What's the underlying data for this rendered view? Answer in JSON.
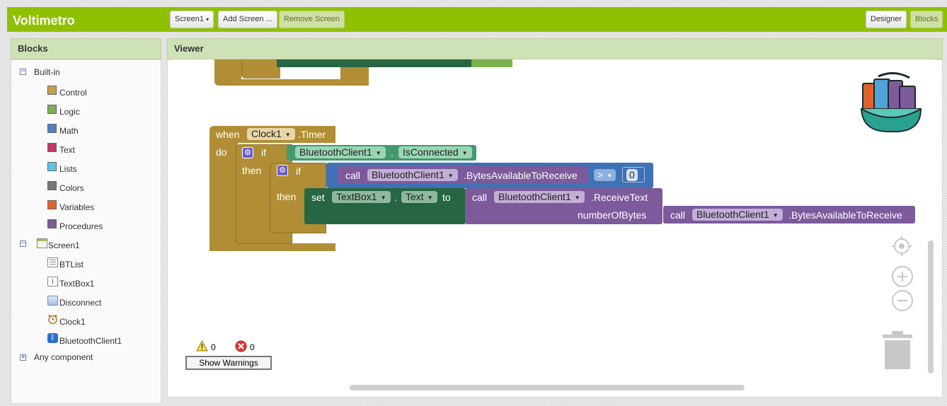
{
  "app": {
    "title": "Voltimetro"
  },
  "toolbar": {
    "screen_select": "Screen1",
    "add_screen": "Add Screen ...",
    "remove_screen": "Remove Screen",
    "designer": "Designer",
    "blocks": "Blocks"
  },
  "blocks_panel": {
    "title": "Blocks",
    "builtin": {
      "label": "Built-in",
      "items": [
        {
          "label": "Control",
          "color": "#c9a04a"
        },
        {
          "label": "Logic",
          "color": "#7db14f"
        },
        {
          "label": "Math",
          "color": "#4f7fc7"
        },
        {
          "label": "Text",
          "color": "#c4386b"
        },
        {
          "label": "Lists",
          "color": "#5fc3e5"
        },
        {
          "label": "Colors",
          "color": "#777777"
        },
        {
          "label": "Variables",
          "color": "#e0632c"
        },
        {
          "label": "Procedures",
          "color": "#7c5a9b"
        }
      ]
    },
    "screen": {
      "label": "Screen1",
      "components": [
        {
          "label": "BTList",
          "icon": "listpicker-icon"
        },
        {
          "label": "TextBox1",
          "icon": "textbox-icon"
        },
        {
          "label": "Disconnect",
          "icon": "button-icon"
        },
        {
          "label": "Clock1",
          "icon": "clock-icon"
        },
        {
          "label": "BluetoothClient1",
          "icon": "bluetooth-icon"
        }
      ]
    },
    "any_component": "Any component"
  },
  "viewer": {
    "title": "Viewer",
    "event_block": {
      "when": "when",
      "component": "Clock1",
      "event": ".Timer",
      "do": "do"
    },
    "if_outer": {
      "if": "if",
      "then": "then",
      "component": "BluetoothClient1",
      "dot": ".",
      "property": "IsConnected"
    },
    "if_inner": {
      "if": "if",
      "then": "then",
      "call": "call",
      "component": "BluetoothClient1",
      "method": ".BytesAvailableToReceive",
      "operator": ">",
      "number": "0"
    },
    "set_block": {
      "set": "set",
      "component": "TextBox1",
      "dot": ".",
      "property": "Text",
      "to": "to"
    },
    "receive_block": {
      "call": "call",
      "component": "BluetoothClient1",
      "method": ".ReceiveText",
      "param": "numberOfBytes"
    },
    "bytes_block": {
      "call": "call",
      "component": "BluetoothClient1",
      "method": ".BytesAvailableToReceive"
    },
    "warnings": {
      "warning_count": "0",
      "error_count": "0",
      "show_warnings": "Show Warnings"
    }
  },
  "colors": {
    "topbar": "#8fc100",
    "control_block": "#b18e35",
    "bluetooth_block": "#439970",
    "math_block": "#3f71b5",
    "call_block": "#7c5a9b",
    "setter_block": "#266643"
  }
}
